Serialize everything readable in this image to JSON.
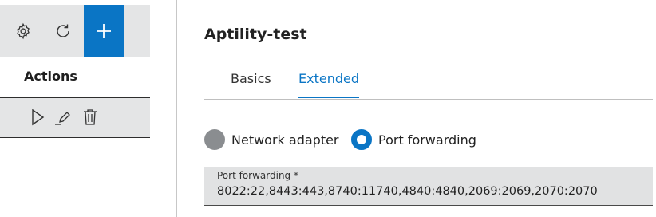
{
  "toolbar": {
    "settings_icon": "gear-icon",
    "refresh_icon": "refresh-icon",
    "add_icon": "plus-icon",
    "accent": "#0a75c5"
  },
  "actions": {
    "title": "Actions",
    "row_icons": [
      "play-icon",
      "pencil-icon",
      "trash-icon"
    ]
  },
  "main": {
    "title": "Aptility-test",
    "tabs": [
      {
        "label": "Basics",
        "active": false
      },
      {
        "label": "Extended",
        "active": true
      }
    ],
    "radios": [
      {
        "label": "Network adapter",
        "selected": false
      },
      {
        "label": "Port forwarding",
        "selected": true
      }
    ],
    "port_field": {
      "label": "Port forwarding *",
      "value": "8022:22,8443:443,8740:11740,4840:4840,2069:2069,2070:2070"
    }
  }
}
